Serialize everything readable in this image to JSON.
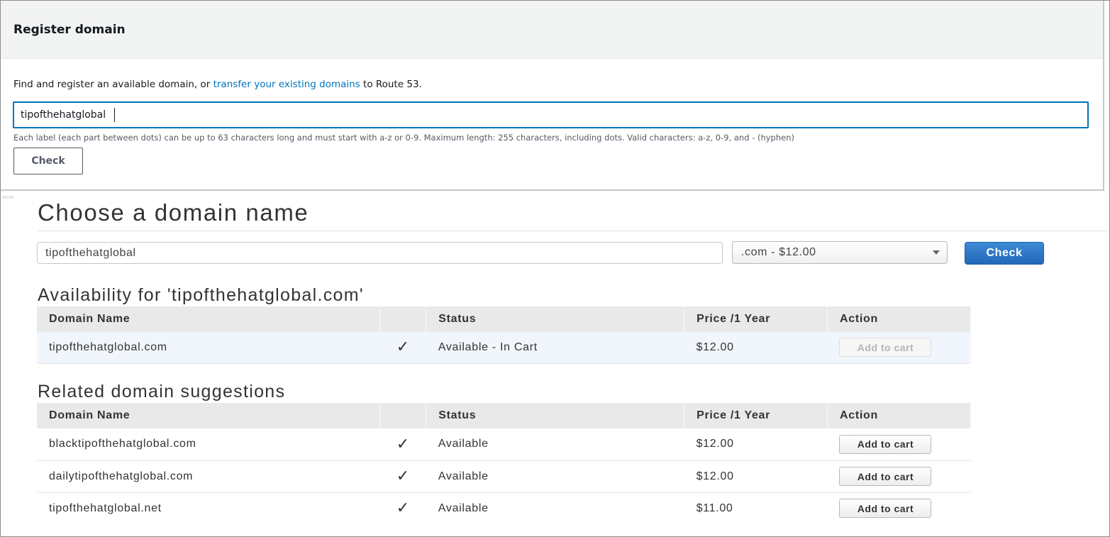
{
  "register": {
    "title": "Register domain",
    "desc_prefix": "Find and register an available domain, or ",
    "desc_link": "transfer your existing domains",
    "desc_suffix": " to Route 53.",
    "input_value": "tipofthehatglobal",
    "hint": "Each label (each part between dots) can be up to 63 characters long and must start with a-z or 0-9. Maximum length: 255 characters, including dots. Valid characters: a-z, 0-9, and - (hyphen)",
    "check_label": "Check",
    "accent_color": "#0073bb"
  },
  "choose": {
    "title": "Choose a domain name",
    "input_value": "tipofthehatglobal",
    "tld_selected": ".com - $12.00",
    "check_label": "Check",
    "check_color": "#2f78c8"
  },
  "availability": {
    "title": "Availability for 'tipofthehatglobal.com'",
    "headers": {
      "name": "Domain Name",
      "status": "Status",
      "price": "Price /1 Year",
      "action": "Action"
    },
    "rows": [
      {
        "name": "tipofthehatglobal.com",
        "icon": "checkmark-icon",
        "status": "Available - In Cart",
        "price": "$12.00",
        "action": "Add to cart",
        "action_disabled": true
      }
    ]
  },
  "suggestions": {
    "title": "Related domain suggestions",
    "headers": {
      "name": "Domain Name",
      "status": "Status",
      "price": "Price /1 Year",
      "action": "Action"
    },
    "rows": [
      {
        "name": "blacktipofthehatglobal.com",
        "icon": "checkmark-icon",
        "status": "Available",
        "price": "$12.00",
        "action": "Add to cart"
      },
      {
        "name": "dailytipofthehatglobal.com",
        "icon": "checkmark-icon",
        "status": "Available",
        "price": "$12.00",
        "action": "Add to cart"
      },
      {
        "name": "tipofthehatglobal.net",
        "icon": "checkmark-icon",
        "status": "Available",
        "price": "$11.00",
        "action": "Add to cart"
      }
    ]
  },
  "colors": {
    "available_check": "#1f9e3c",
    "link": "#0073bb"
  }
}
